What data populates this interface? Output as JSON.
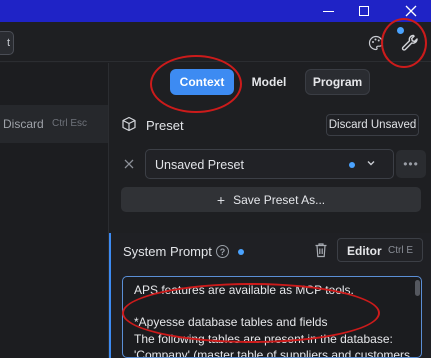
{
  "toolbar": {
    "left_stub_label": "t"
  },
  "left_pane": {
    "discard_label": "Discard",
    "discard_shortcut": "Ctrl Esc"
  },
  "tabs": [
    {
      "label": "Context",
      "active": true
    },
    {
      "label": "Model",
      "active": false
    },
    {
      "label": "Program",
      "active": false
    }
  ],
  "preset": {
    "label": "Preset",
    "discard_unsaved_label": "Discard Unsaved",
    "selected_value": "Unsaved Preset",
    "more_label": "•••",
    "save_as_label": "Save Preset As..."
  },
  "system_prompt": {
    "title": "System Prompt",
    "help_label": "?",
    "editor_label": "Editor",
    "editor_shortcut": "Ctrl E",
    "lines": [
      "APS features are available as MCP tools.",
      "",
      "*Apyesse database tables and fields",
      "The following tables are present in the database:",
      "'Company' (master table of suppliers and customers"
    ]
  },
  "icons": {
    "palette": "palette-icon",
    "wrench": "wrench-icon",
    "cube": "cube-icon",
    "trash": "trash-icon"
  },
  "colors": {
    "titlebar": "#1f23c6",
    "accent": "#3d8bf2",
    "annotation_ring": "#cc1b1b",
    "modified_dot": "#4aa3ff"
  }
}
